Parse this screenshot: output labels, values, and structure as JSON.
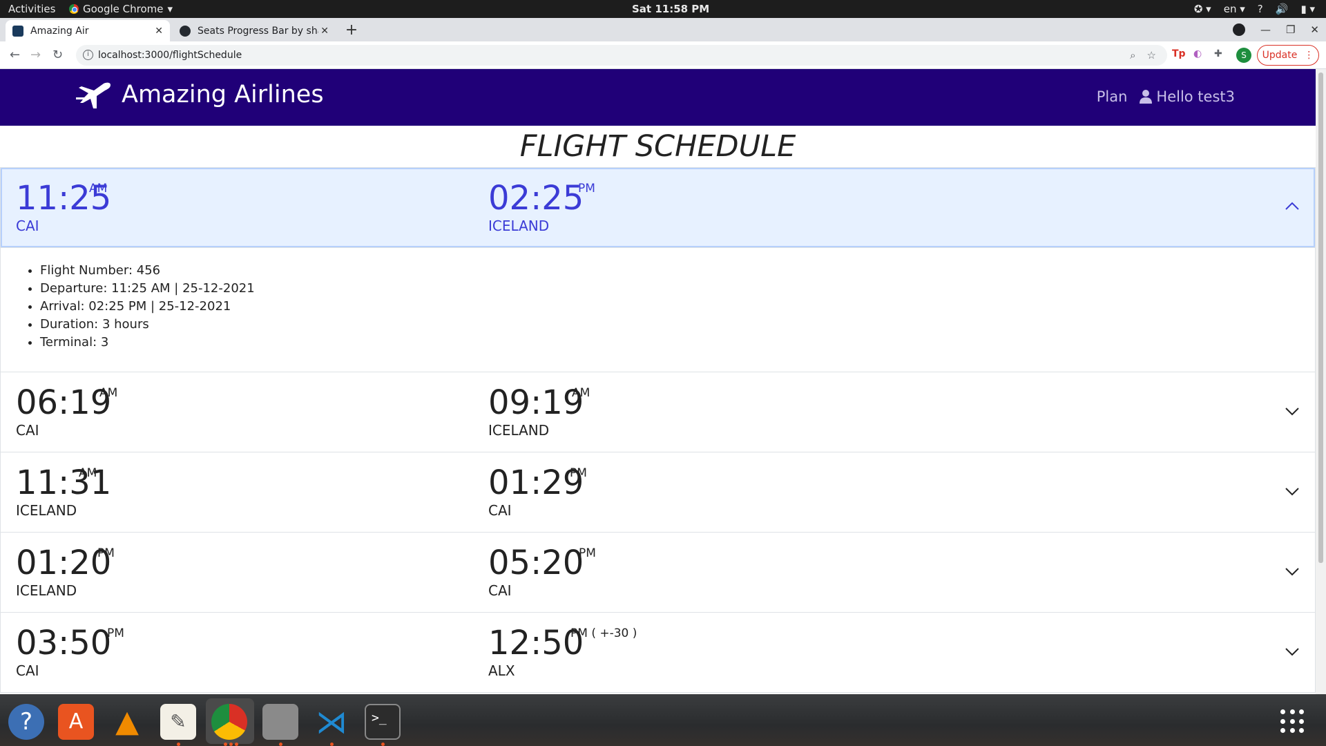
{
  "system": {
    "activities": "Activities",
    "app_name": "Google Chrome",
    "clock": "Sat 11:58 PM",
    "language": "en"
  },
  "browser": {
    "tabs": [
      {
        "title": "Amazing Air",
        "active": true
      },
      {
        "title": "Seats Progress Bar by sha",
        "active": false
      }
    ],
    "url": "localhost:3000/flightSchedule",
    "profile_letter": "S",
    "update_label": "Update"
  },
  "navbar": {
    "brand": "Amazing Airlines",
    "plan": "Plan",
    "user": "Hello test3"
  },
  "page_title": "FLIGHT SCHEDULE",
  "flights": [
    {
      "dep_time": "11:25",
      "dep_ampm": "AM",
      "dep_city": "CAI",
      "arr_time": "02:25",
      "arr_ampm": "PM",
      "arr_city": "ICELAND",
      "expanded": true,
      "details": [
        "Flight Number: 456",
        "Departure: 11:25 AM | 25-12-2021",
        "Arrival: 02:25 PM | 25-12-2021",
        "Duration: 3 hours",
        "Terminal: 3"
      ]
    },
    {
      "dep_time": "06:19",
      "dep_ampm": "AM",
      "dep_city": "CAI",
      "arr_time": "09:19",
      "arr_ampm": "AM",
      "arr_city": "ICELAND",
      "expanded": false
    },
    {
      "dep_time": "11:31",
      "dep_ampm": "AM",
      "dep_city": "ICELAND",
      "arr_time": "01:29",
      "arr_ampm": "PM",
      "arr_city": "CAI",
      "expanded": false
    },
    {
      "dep_time": "01:20",
      "dep_ampm": "PM",
      "dep_city": "ICELAND",
      "arr_time": "05:20",
      "arr_ampm": "PM",
      "arr_city": "CAI",
      "expanded": false
    },
    {
      "dep_time": "03:50",
      "dep_ampm": "PM",
      "dep_city": "CAI",
      "arr_time": "12:50",
      "arr_ampm": "PM ( +-30 )",
      "arr_city": "ALX",
      "expanded": false
    }
  ],
  "colors": {
    "navbar": "#200078",
    "active_text": "#3b3bd6",
    "active_bg": "#e7f1ff"
  }
}
